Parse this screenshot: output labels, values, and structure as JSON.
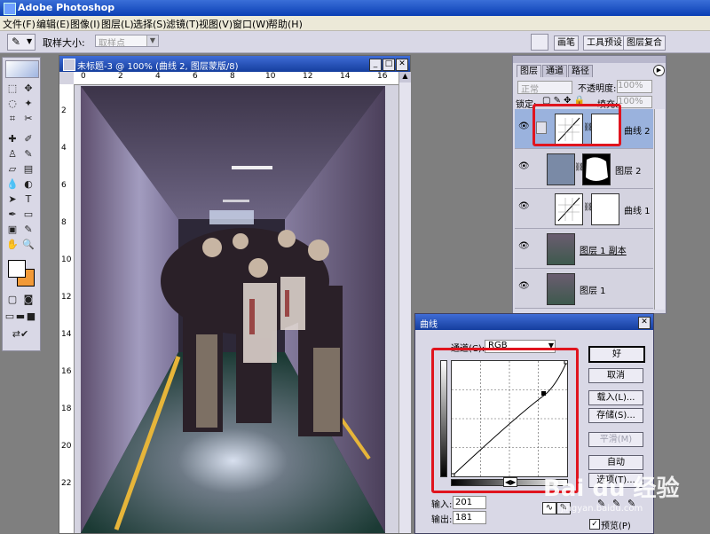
{
  "app": {
    "title": "Adobe Photoshop"
  },
  "menu": [
    "文件(F)",
    "编辑(E)",
    "图像(I)",
    "图层(L)",
    "选择(S)",
    "滤镜(T)",
    "视图(V)",
    "窗口(W)",
    "帮助(H)"
  ],
  "options": {
    "sample_label": "取样大小:",
    "sample_value": "取样点",
    "tabs": [
      "画笔",
      "工具预设",
      "图层复合"
    ]
  },
  "document": {
    "title": "未标题-3 @ 100% (曲线 2, 图层蒙版/8)",
    "ruler_top": [
      "0",
      "2",
      "4",
      "6",
      "8",
      "10",
      "12",
      "14",
      "16"
    ],
    "ruler_left": [
      "2",
      "4",
      "6",
      "8",
      "10",
      "12",
      "14",
      "16",
      "18",
      "20",
      "22"
    ]
  },
  "layers_panel": {
    "tabs": [
      "图层",
      "通道",
      "路径"
    ],
    "blend_mode": "正常",
    "opacity_label": "不透明度:",
    "opacity_value": "100%",
    "lock_label": "锁定:",
    "fill_label": "填充:",
    "fill_value": "100%",
    "layers": [
      {
        "name": "曲线 2",
        "selected": true
      },
      {
        "name": "图层 2",
        "selected": false
      },
      {
        "name": "曲线 1",
        "selected": false
      },
      {
        "name": "图层 1 副本",
        "selected": false
      },
      {
        "name": "图层 1",
        "selected": false
      }
    ]
  },
  "curves_dialog": {
    "title": "曲线",
    "channel_label": "通道(C):",
    "channel_value": "RGB",
    "buttons": {
      "ok": "好",
      "cancel": "取消",
      "load": "载入(L)...",
      "save": "存储(S)...",
      "smooth": "平滑(M)",
      "auto": "自动",
      "options": "选项(T)..."
    },
    "input_label": "输入:",
    "input_value": "201",
    "output_label": "输出:",
    "output_value": "181",
    "preview_label": "预览(P)",
    "preview_checked": true
  },
  "watermark": {
    "main": "Bai du 经验",
    "sub": "jingyan.baidu.com"
  },
  "colors": {
    "highlight": "#e0141e",
    "title_blue": "#153e9e",
    "foreground": "#ffffff",
    "background": "#f29a38"
  }
}
